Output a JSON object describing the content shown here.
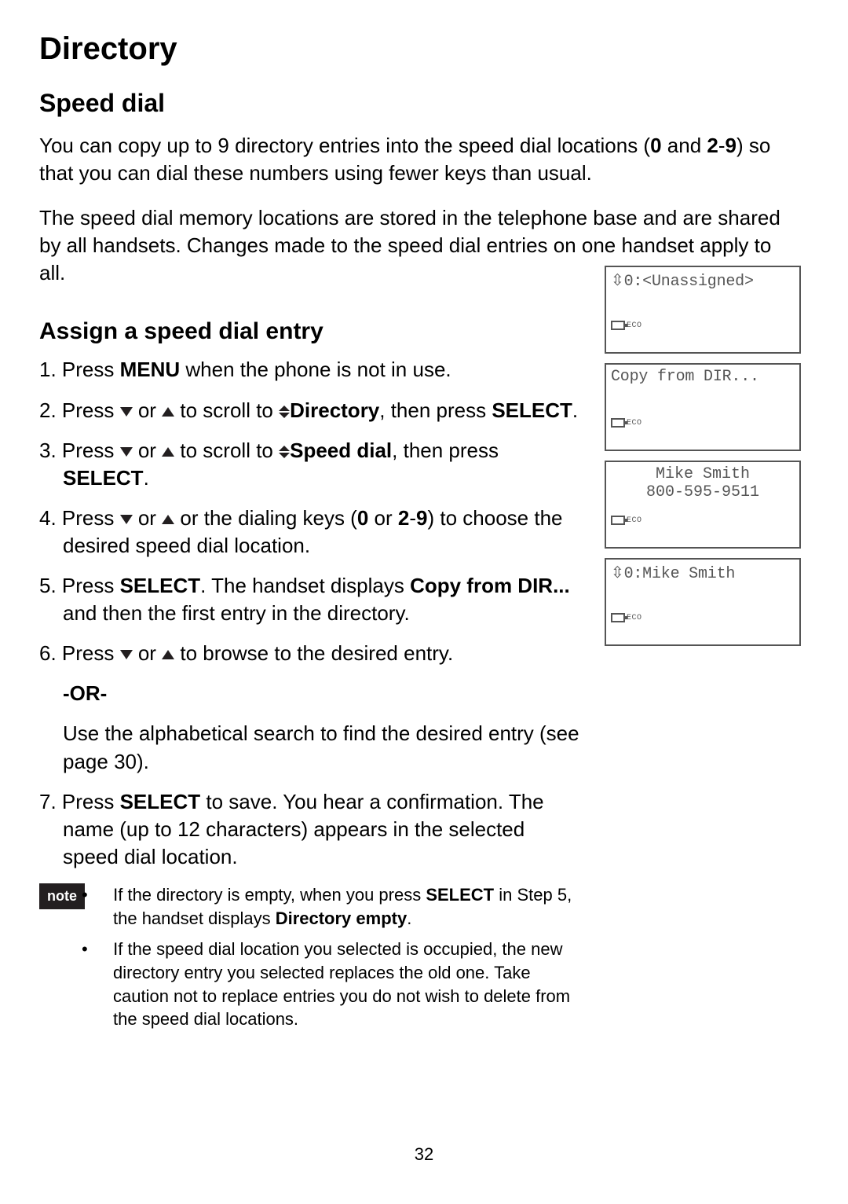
{
  "title": "Directory",
  "section": "Speed dial",
  "para1_a": "You can copy up to 9 directory entries into the speed dial locations (",
  "para1_b": " and ",
  "para1_c": "-",
  "para1_d": ") so that you can dial these numbers using fewer keys than usual.",
  "num0": "0",
  "num2": "2",
  "num9": "9",
  "para2": "The speed dial memory locations are stored in the telephone base and are shared by all handsets. Changes made to the speed dial entries on one handset apply to all.",
  "subsection": "Assign a speed dial entry",
  "steps": {
    "s1_a": "1. Press ",
    "s1_menu": "MENU",
    "s1_b": " when the phone is not in use.",
    "s2_a": "2. Press ",
    "s2_b": " or ",
    "s2_c": " to scroll to ",
    "s2_dir": "Directory",
    "s2_d": ", then press ",
    "s2_sel": "SELECT",
    "s2_e": ".",
    "s3_a": "3. Press ",
    "s3_b": " or ",
    "s3_c": " to scroll to ",
    "s3_sd": "Speed dial",
    "s3_d": ", then press ",
    "s3_sel": "SELECT",
    "s3_e": ".",
    "s4_a": "4. Press ",
    "s4_b": " or ",
    "s4_c": " or the dialing keys (",
    "s4_d": " or ",
    "s4_e": "-",
    "s4_f": ") to choose the desired speed dial location.",
    "s5_a": "5. Press ",
    "s5_sel": "SELECT",
    "s5_b": ". The handset displays ",
    "s5_copy": "Copy from DIR...",
    "s5_c": " and then the first entry in the directory.",
    "s6_a": "6. Press ",
    "s6_b": " or ",
    "s6_c": " to browse to the desired entry.",
    "or": "-OR-",
    "s6_alt": "Use the alphabetical search to find the desired entry (see page 30).",
    "s7_a": "7. Press ",
    "s7_sel": "SELECT",
    "s7_b": " to save. You hear a confirmation. The name (up to 12 characters) appears in the selected speed dial location."
  },
  "note_label": "note",
  "notes": {
    "n1_a": "If the directory is empty, when you press ",
    "n1_sel": "SELECT",
    "n1_b": " in Step 5, the handset displays ",
    "n1_empty": "Directory empty",
    "n1_c": ".",
    "n2": "If the speed dial location you selected is occupied, the new directory entry you selected replaces the old one. Take caution not to replace entries you do not wish to delete from the speed dial locations."
  },
  "screens": {
    "eco": "ECO",
    "sc1_line1": "0:<Unassigned>",
    "sc2_line1": "Copy from DIR...",
    "sc3_line1": "Mike Smith",
    "sc3_line2": "800-595-9511",
    "sc4_line1": "0:Mike Smith"
  },
  "page_number": "32"
}
